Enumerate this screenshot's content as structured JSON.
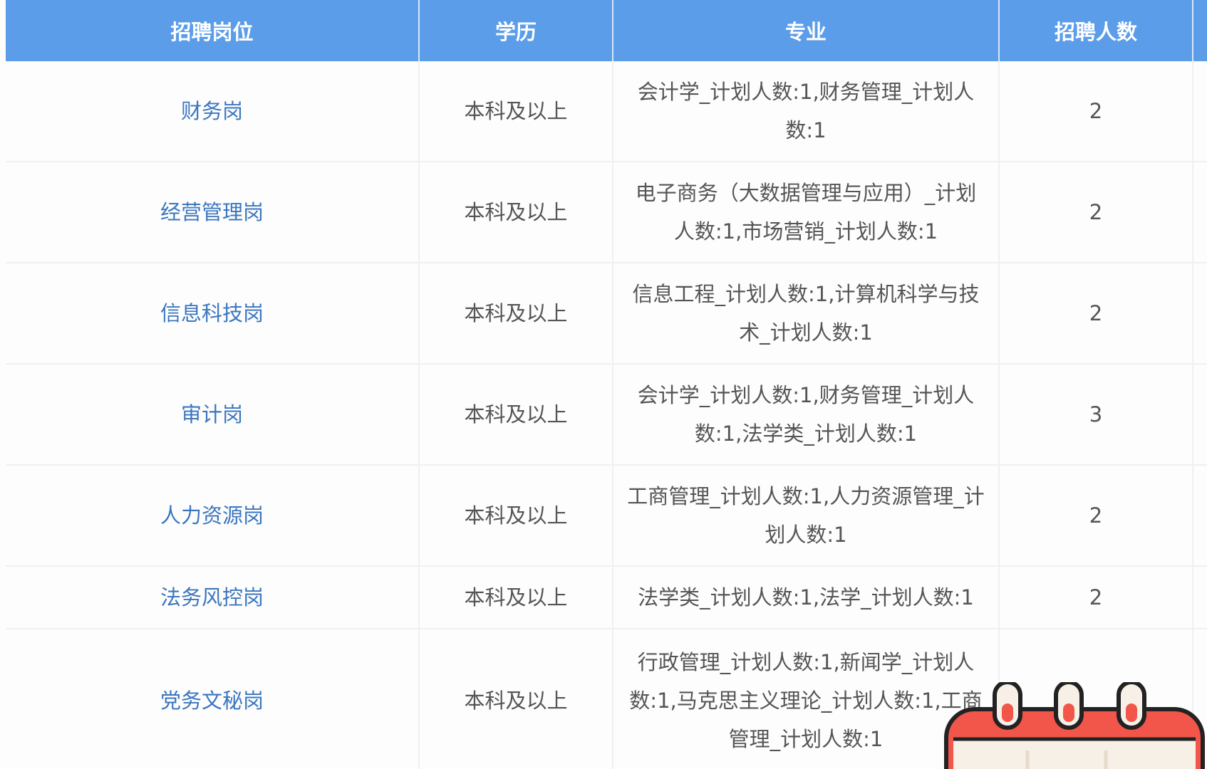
{
  "table": {
    "headers": [
      "招聘岗位",
      "学历",
      "专业",
      "招聘人数"
    ],
    "rows": [
      {
        "position": "财务岗",
        "education": "本科及以上",
        "major": "会计学_计划人数:1,财务管理_计划人数:1",
        "count": "2"
      },
      {
        "position": "经营管理岗",
        "education": "本科及以上",
        "major": "电子商务（大数据管理与应用）_计划人数:1,市场营销_计划人数:1",
        "count": "2"
      },
      {
        "position": "信息科技岗",
        "education": "本科及以上",
        "major": "信息工程_计划人数:1,计算机科学与技术_计划人数:1",
        "count": "2"
      },
      {
        "position": "审计岗",
        "education": "本科及以上",
        "major": "会计学_计划人数:1,财务管理_计划人数:1,法学类_计划人数:1",
        "count": "3"
      },
      {
        "position": "人力资源岗",
        "education": "本科及以上",
        "major": "工商管理_计划人数:1,人力资源管理_计划人数:1",
        "count": "2"
      },
      {
        "position": "法务风控岗",
        "education": "本科及以上",
        "major": "法学类_计划人数:1,法学_计划人数:1",
        "count": "2"
      },
      {
        "position": "党务文秘岗",
        "education": "本科及以上",
        "major": "行政管理_计划人数:1,新闻学_计划人数:1,马克思主义理论_计划人数:1,工商管理_计划人数:1",
        "count": ""
      }
    ]
  },
  "colors": {
    "header_bg": "#5b9de8",
    "position_text": "#3b76c0",
    "calendar_red": "#f2554a"
  },
  "icons": {
    "calendar": "calendar-icon"
  }
}
